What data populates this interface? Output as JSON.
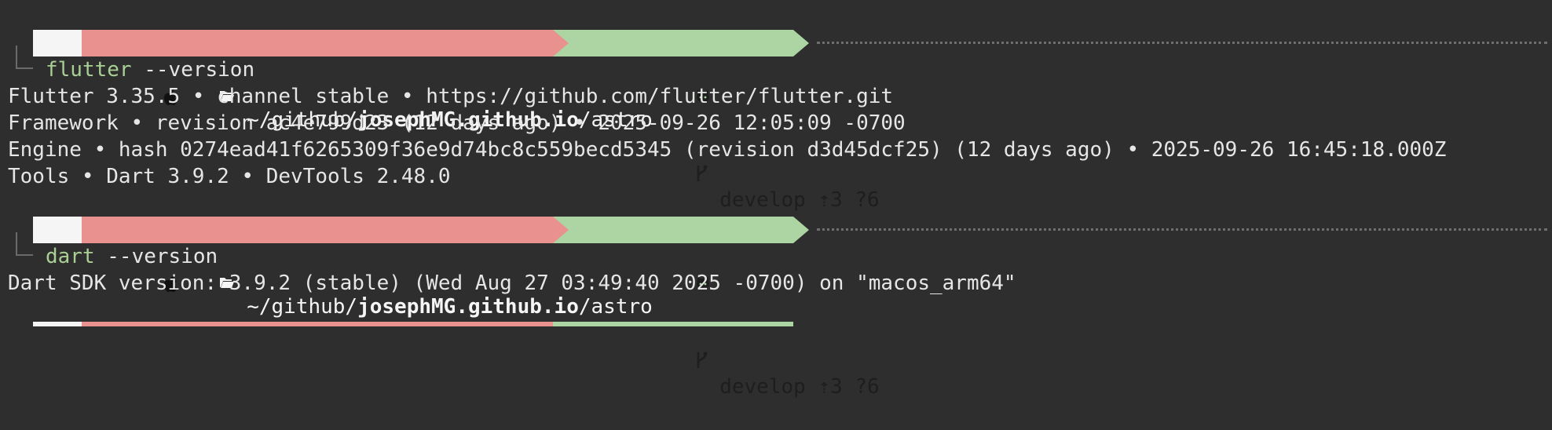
{
  "prompts": [
    {
      "path_prefix": "~/github/",
      "path_bold": "josephMG.github.io",
      "path_suffix": "/astro",
      "branch": "develop",
      "ahead": "⇡3",
      "untracked": "?6",
      "command": "flutter",
      "args": " --version"
    },
    {
      "path_prefix": "~/github/",
      "path_bold": "josephMG.github.io",
      "path_suffix": "/astro",
      "branch": "develop",
      "ahead": "⇡3",
      "untracked": "?6",
      "command": "dart",
      "args": " --version"
    }
  ],
  "output": {
    "flutter": [
      "Flutter 3.35.5 • channel stable • https://github.com/flutter/flutter.git",
      "Framework • revision ac4e799d23 (12 days ago) • 2025-09-26 12:05:09 -0700",
      "Engine • hash 0274ead41f6265309f36e9d74bc8c559becd5345 (revision d3d45dcf25) (12 days ago) • 2025-09-26 16:45:18.000Z",
      "Tools • Dart 3.9.2 • DevTools 2.48.0"
    ],
    "dart": [
      "Dart SDK version: 3.9.2 (stable) (Wed Aug 27 03:49:40 2025 -0700) on \"macos_arm64\""
    ]
  },
  "icons": {
    "os": "apple-icon",
    "folder": "folder-open-icon",
    "vcs": "github-icon",
    "branch": "git-branch-icon"
  },
  "colors": {
    "background": "#2e2e2e",
    "os_segment": "#f5f5f5",
    "path_segment": "#e8918f",
    "git_segment": "#add5a4",
    "command": "#a9cf95"
  }
}
